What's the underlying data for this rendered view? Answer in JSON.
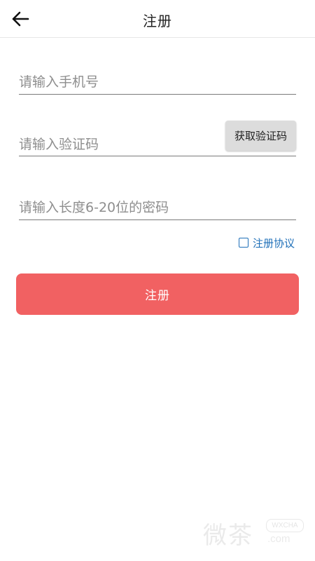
{
  "header": {
    "title": "注册",
    "back_icon": "arrow-left-icon"
  },
  "form": {
    "phone_placeholder": "请输入手机号",
    "code_placeholder": "请输入验证码",
    "get_code_label": "获取验证码",
    "password_placeholder": "请输入长度6-20位的密码",
    "agreement_label": "注册协议",
    "submit_label": "注册"
  },
  "watermark": {
    "cn_text": "微茶",
    "badge_text": "WXCHA",
    "domain_text": ".com"
  },
  "colors": {
    "accent": "#f16162",
    "link": "#1e6fb8"
  }
}
